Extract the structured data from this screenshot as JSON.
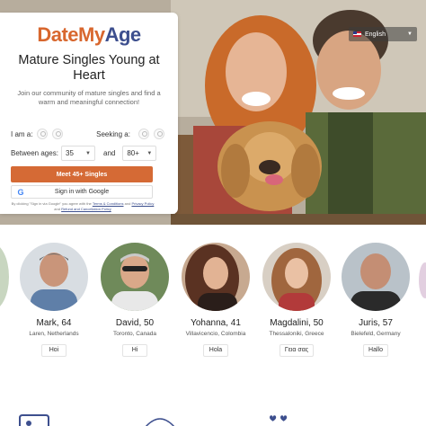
{
  "header": {
    "language": {
      "label": "English",
      "flag": "us-flag-icon"
    }
  },
  "signup": {
    "logo_part1": "DateMy",
    "logo_part2": "Age",
    "heading": "Mature Singles Young at Heart",
    "subheading": "Join our community of mature singles and find a warm and meaningful connection!",
    "i_am_label": "I am a:",
    "seeking_label": "Seeking a:",
    "ages_label": "Between ages:",
    "age_min": "35",
    "and_label": "and",
    "age_max": "80+",
    "meet_button": "Meet 45+ Singles",
    "google_button": "Sign in with Google",
    "legal_prefix": "By clicking \"Sign in via Google\" you agree with the",
    "legal_terms": "Terms & Conditions",
    "legal_and1": "and",
    "legal_privacy": "Privacy Policy",
    "legal_and2": "and",
    "legal_refund": "Refund and Cancellation Policy"
  },
  "profiles": [
    {
      "name": "Mark, 64",
      "location": "Laren, Netherlands",
      "greeting": "Hoi"
    },
    {
      "name": "David, 50",
      "location": "Toronto, Canada",
      "greeting": "Hi"
    },
    {
      "name": "Yohanna, 41",
      "location": "Villavicencio, Colombia",
      "greeting": "Hola"
    },
    {
      "name": "Magdalini, 50",
      "location": "Thessaloniki, Greece",
      "greeting": "Γεια σας"
    },
    {
      "name": "Juris, 57",
      "location": "Bielefeld, Germany",
      "greeting": "Hallo"
    }
  ],
  "colors": {
    "brand_orange": "#d56a35",
    "brand_blue": "#3d4f8e"
  }
}
